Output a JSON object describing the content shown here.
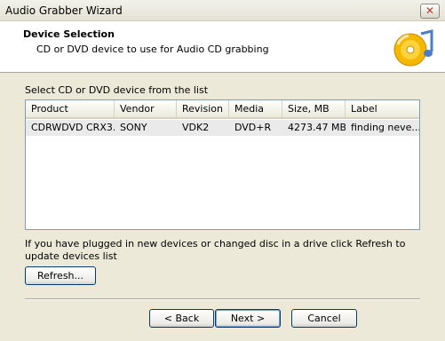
{
  "window": {
    "title": "Audio Grabber Wizard",
    "close_glyph": "✕"
  },
  "header": {
    "title": "Device Selection",
    "subtitle": "CD or DVD device to use for Audio CD grabbing",
    "icon": "cd-music-icon"
  },
  "list": {
    "label": "Select CD or DVD device from the list",
    "columns": [
      "Product",
      "Vendor",
      "Revision",
      "Media",
      "Size, MB",
      "Label"
    ],
    "rows": [
      [
        "CDRWDVD CRX3...",
        "SONY",
        "VDK2",
        "DVD+R",
        "4273.47 MB",
        "finding neve..."
      ]
    ]
  },
  "info": {
    "text": "If you have plugged in new devices or changed disc in a drive click Refresh to update devices list"
  },
  "buttons": {
    "refresh": "Refresh...",
    "back": "< Back",
    "next": "Next >",
    "cancel": "Cancel"
  },
  "colors": {
    "accent": "#7da2ce",
    "cd_gold": "#f5b800",
    "note_blue": "#4a7ec8"
  }
}
